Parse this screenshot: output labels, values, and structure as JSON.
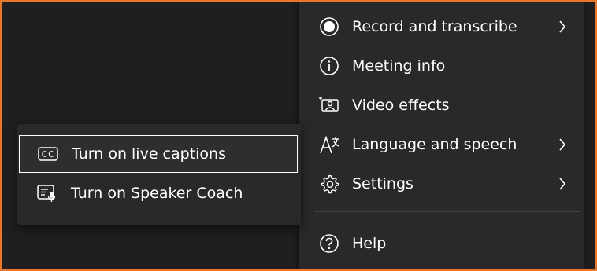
{
  "colors": {
    "frame_border": "#e8762d",
    "background": "#1f1f1f",
    "menu_background": "#292929",
    "text": "#ffffff",
    "focus_outline": "#ffffff"
  },
  "main_menu": {
    "items": [
      {
        "label": "Record and transcribe",
        "icon": "record-icon",
        "has_submenu": true
      },
      {
        "label": "Meeting info",
        "icon": "info-icon",
        "has_submenu": false
      },
      {
        "label": "Video effects",
        "icon": "video-effects-icon",
        "has_submenu": false
      },
      {
        "label": "Language and speech",
        "icon": "language-icon",
        "has_submenu": true
      },
      {
        "label": "Settings",
        "icon": "gear-icon",
        "has_submenu": true
      },
      {
        "label": "Help",
        "icon": "help-icon",
        "has_submenu": false
      }
    ]
  },
  "submenu": {
    "items": [
      {
        "label": "Turn on live captions",
        "icon": "captions-icon",
        "focused": true
      },
      {
        "label": "Turn on Speaker Coach",
        "icon": "speaker-coach-icon",
        "focused": false
      }
    ]
  }
}
